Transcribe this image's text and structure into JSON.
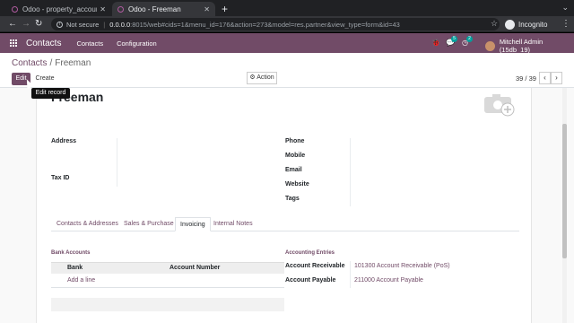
{
  "browser": {
    "tabs": [
      {
        "title": "Odoo - property_account",
        "active": false
      },
      {
        "title": "Odoo - Freeman",
        "active": true
      }
    ],
    "new_tab_icon": "plus-icon",
    "security_label": "Not secure",
    "url_host": "0.0.0.0",
    "url_path": ":8015/web#cids=1&menu_id=176&action=273&model=res.partner&view_type=form&id=43",
    "profile_label": "Incognito"
  },
  "navbar": {
    "app_name": "Contacts",
    "menu": [
      "Contacts",
      "Configuration"
    ],
    "chat_badge": "5",
    "activity_badge": "2",
    "user": "Mitchell Admin (15db_19)"
  },
  "control_panel": {
    "breadcrumb": [
      "Contacts",
      "Freeman"
    ],
    "edit_label": "Edit",
    "create_label": "Create",
    "action_label": "Action",
    "pager": "39 / 39",
    "tooltip": "Edit record"
  },
  "form": {
    "title": "Freeman",
    "left_fields": [
      "Address",
      "Tax ID"
    ],
    "right_fields": [
      "Phone",
      "Mobile",
      "Email",
      "Website",
      "Tags"
    ],
    "tabs": [
      "Contacts & Addresses",
      "Sales & Purchase",
      "Invoicing",
      "Internal Notes"
    ],
    "active_tab": "Invoicing",
    "bank_section": {
      "title": "Bank Accounts",
      "columns": [
        "Bank",
        "Account Number"
      ],
      "add_line": "Add a line"
    },
    "accounting_section": {
      "title": "Accounting Entries",
      "rows": [
        {
          "label": "Account Receivable",
          "value": "101300 Account Receivable (PoS)"
        },
        {
          "label": "Account Payable",
          "value": "211000 Account Payable"
        }
      ]
    }
  },
  "colors": {
    "brand": "#714b67",
    "chrome_dark": "#202124",
    "chrome_tab": "#35363a"
  }
}
